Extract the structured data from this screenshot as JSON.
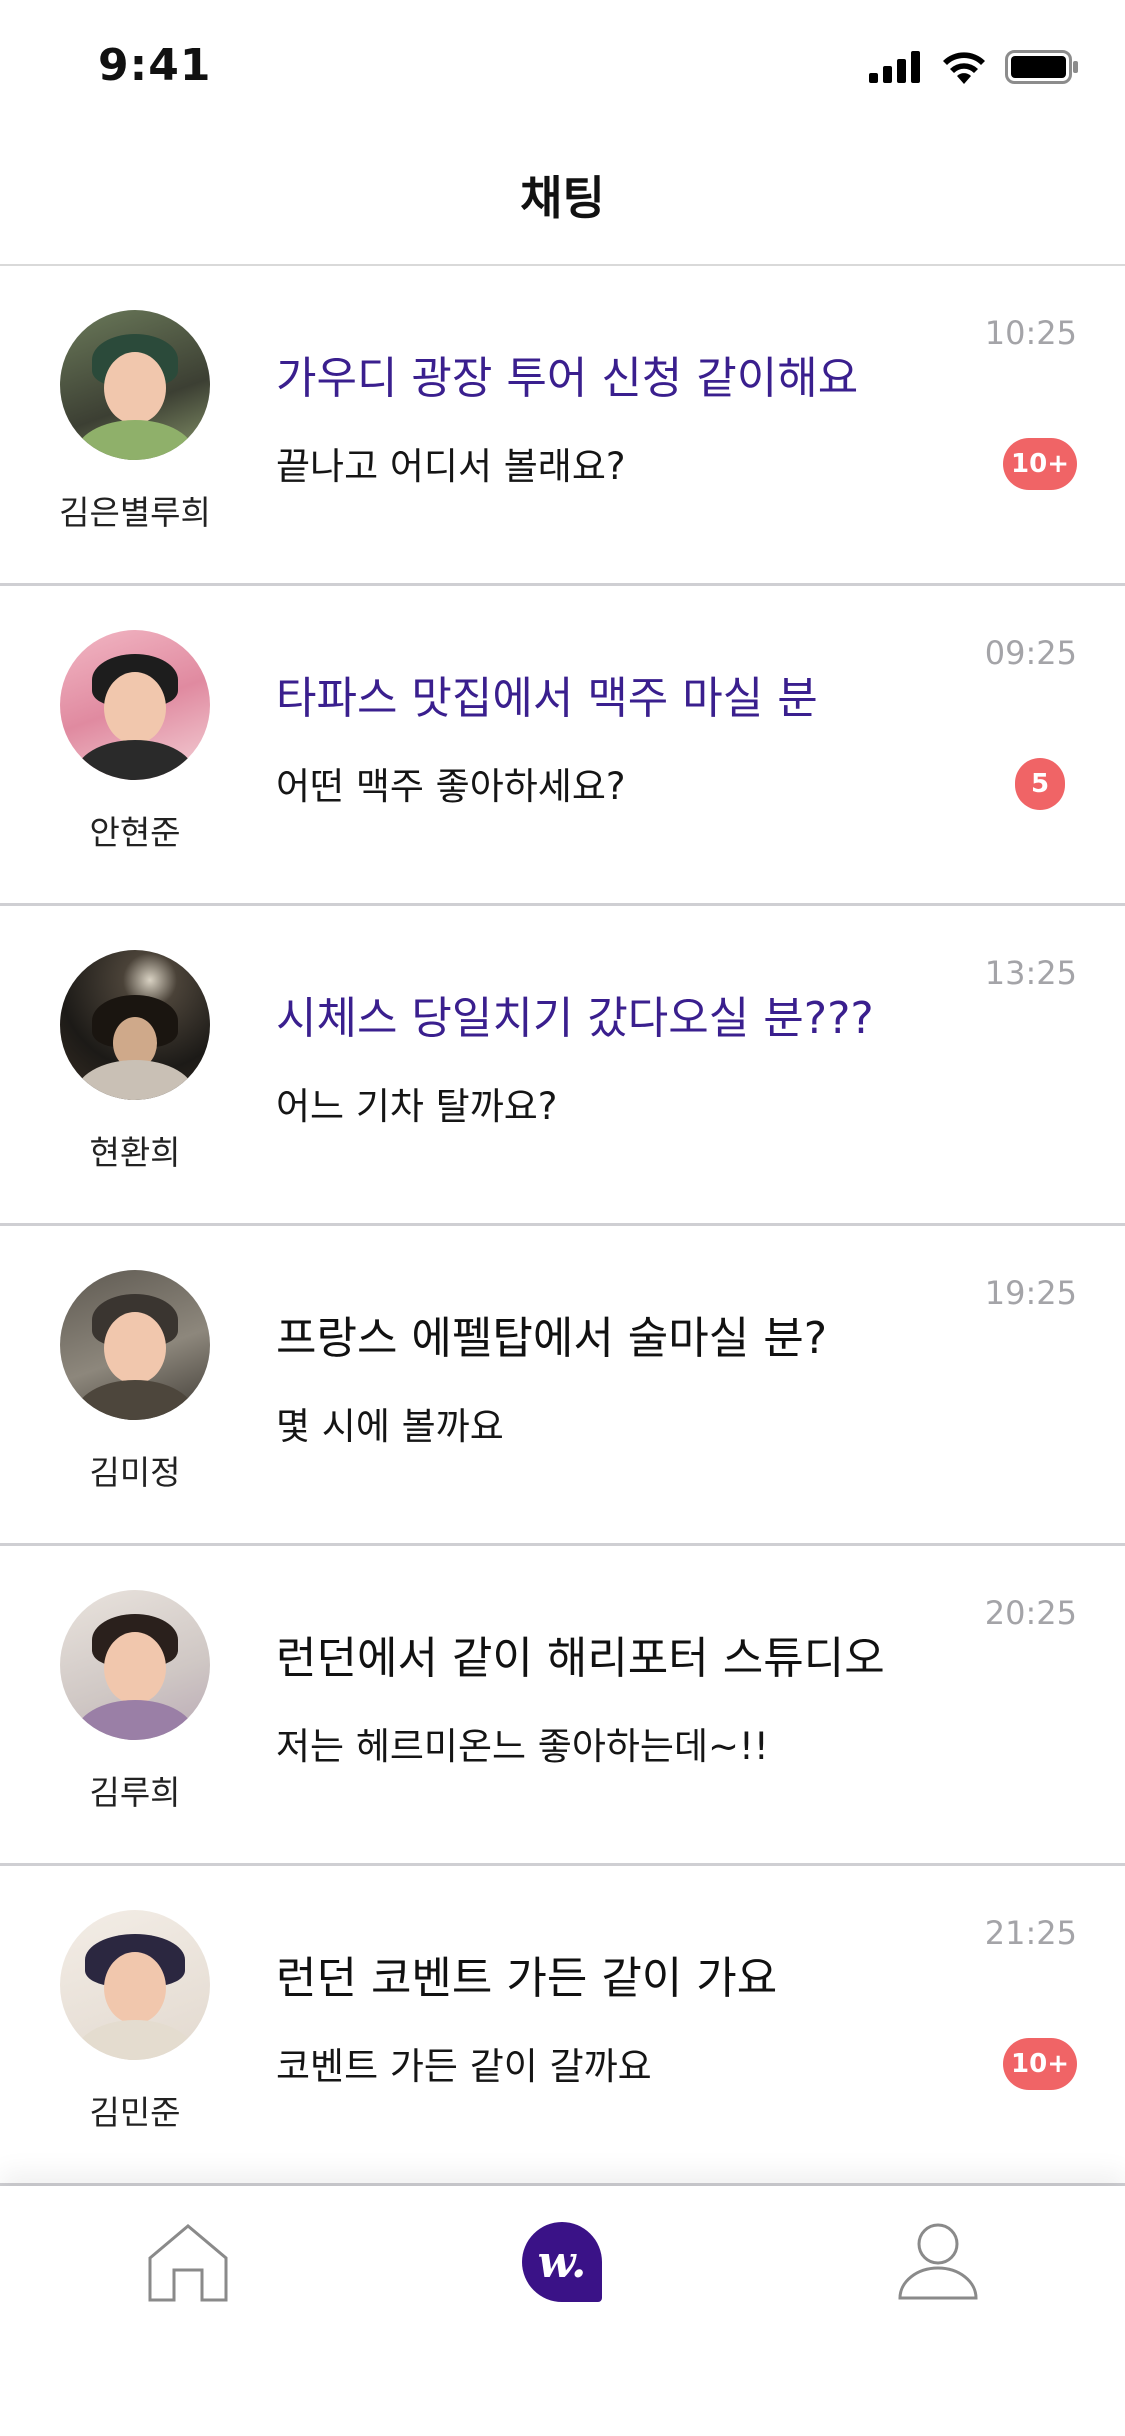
{
  "status_bar": {
    "time": "9:41"
  },
  "header": {
    "title": "채팅"
  },
  "chats": [
    {
      "name": "김은별루희",
      "title": "가우디 광장 투어 신청 같이해요",
      "message": "끝나고 어디서 볼래요?",
      "time": "10:25",
      "badge": "10+",
      "title_highlight": true
    },
    {
      "name": "안현준",
      "title": "타파스 맛집에서 맥주 마실 분",
      "message": "어떤 맥주 좋아하세요?",
      "time": "09:25",
      "badge": "5",
      "title_highlight": true
    },
    {
      "name": "현환희",
      "title": "시체스 당일치기 갔다오실 분???",
      "message": "어느 기차 탈까요?",
      "time": "13:25",
      "badge": "",
      "title_highlight": true
    },
    {
      "name": "김미정",
      "title": "프랑스 에펠탑에서 술마실 분?",
      "message": "몇 시에 볼까요",
      "time": "19:25",
      "badge": "",
      "title_highlight": false
    },
    {
      "name": "김루희",
      "title": "런던에서 같이 해리포터 스튜디오",
      "message": "저는 헤르미온느 좋아하는데~!!",
      "time": "20:25",
      "badge": "",
      "title_highlight": false
    },
    {
      "name": "김민준",
      "title": "런던 코벤트 가든 같이 가요",
      "message": "코벤트 가든 같이 갈까요",
      "time": "21:25",
      "badge": "10+",
      "title_highlight": false
    }
  ],
  "bottom_nav": {
    "items": [
      {
        "icon": "home-icon",
        "active": false
      },
      {
        "icon": "chat-logo-icon",
        "active": true,
        "logo_text": "w."
      },
      {
        "icon": "profile-icon",
        "active": false
      }
    ]
  },
  "colors": {
    "accent": "#3a1287",
    "badge": "#f06466",
    "time_text": "#a4a4a8",
    "highlight_title": "#3a1f8e"
  }
}
